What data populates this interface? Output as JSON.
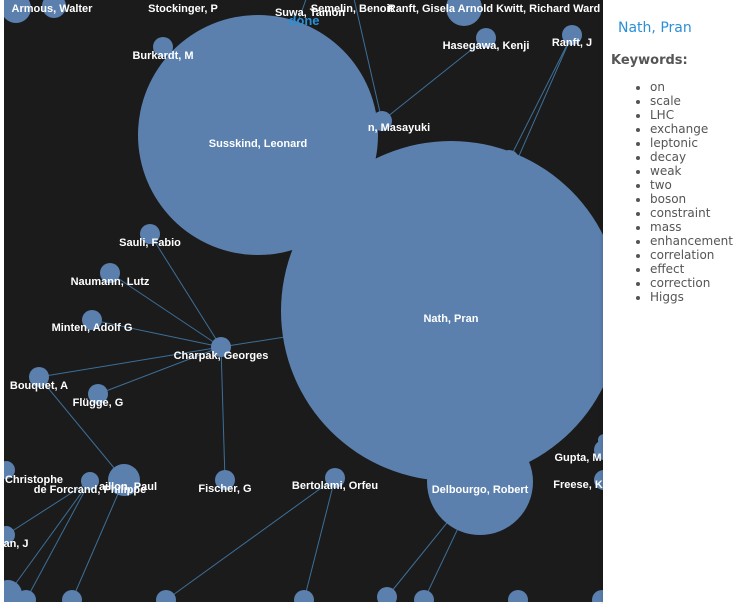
{
  "status_text": "done",
  "sidebar": {
    "selected_name": "Nath, Pran",
    "keywords_title": "Keywords:",
    "keywords": [
      "on",
      "scale",
      "LHC",
      "exchange",
      "leptonic",
      "decay",
      "weak",
      "two",
      "boson",
      "constraint",
      "mass",
      "enhancement",
      "correlation",
      "effect",
      "correction",
      "Higgs"
    ]
  },
  "graph": {
    "node_fill": "#5b80ae",
    "edge_color": "#3d6f98",
    "background": "#1b1b1b",
    "nodes": [
      {
        "id": "armous",
        "label": "Armous, Walter"
      },
      {
        "id": "stockinger",
        "label": "Stockinger, P"
      },
      {
        "id": "suwa",
        "label": "Suwa, Tamon"
      },
      {
        "id": "semelin",
        "label": "Semelin, Benoit"
      },
      {
        "id": "raft_cluster",
        "label": "Ranft, Gisela Arnold Kwitt, Richard Ward"
      },
      {
        "id": "burkardt",
        "label": "Burkardt, M"
      },
      {
        "id": "hasegawa",
        "label": "Hasegawa, Kenji"
      },
      {
        "id": "ranft",
        "label": "Ranft, J"
      },
      {
        "id": "masayuki",
        "label": "n, Masayuki"
      },
      {
        "id": "susskind",
        "label": "Susskind, Leonard"
      },
      {
        "id": "nath",
        "label": "Nath, Pran"
      },
      {
        "id": "sauli",
        "label": "Sauli, Fabio"
      },
      {
        "id": "naumann",
        "label": "Naumann, Lutz"
      },
      {
        "id": "minten",
        "label": "Minten, Adolf G"
      },
      {
        "id": "charpak",
        "label": "Charpak, Georges"
      },
      {
        "id": "bouquet",
        "label": "Bouquet, A"
      },
      {
        "id": "flugge",
        "label": "Flügge, G"
      },
      {
        "id": "christophe",
        "label": "Christophe"
      },
      {
        "id": "deforcrand",
        "label": "de Forcrand, Philippe"
      },
      {
        "id": "paul",
        "label": "aillon, Paul"
      },
      {
        "id": "fischer",
        "label": "Fischer, G"
      },
      {
        "id": "bertolami",
        "label": "Bertolami, Orfeu"
      },
      {
        "id": "delbourgo",
        "label": "Delbourgo, Robert"
      },
      {
        "id": "gupta",
        "label": "Gupta, M"
      },
      {
        "id": "freese",
        "label": "Freese, K"
      },
      {
        "id": "anj",
        "label": "an, J"
      },
      {
        "id": "b1",
        "label": ""
      },
      {
        "id": "b2",
        "label": ""
      },
      {
        "id": "b3",
        "label": ""
      },
      {
        "id": "b4",
        "label": ""
      },
      {
        "id": "b5",
        "label": ""
      },
      {
        "id": "b6",
        "label": ""
      },
      {
        "id": "b7",
        "label": ""
      },
      {
        "id": "b8",
        "label": ""
      },
      {
        "id": "b9",
        "label": ""
      },
      {
        "id": "b10",
        "label": ""
      },
      {
        "id": "tr1",
        "label": ""
      },
      {
        "id": "tr2",
        "label": ""
      }
    ],
    "edges": [
      [
        "charpak",
        "sauli"
      ],
      [
        "charpak",
        "naumann"
      ],
      [
        "charpak",
        "minten"
      ],
      [
        "charpak",
        "bouquet"
      ],
      [
        "charpak",
        "flugge"
      ],
      [
        "charpak",
        "fischer"
      ],
      [
        "charpak",
        "nath"
      ],
      [
        "masayuki",
        "susskind"
      ],
      [
        "masayuki",
        "hasegawa"
      ],
      [
        "masayuki",
        "semelin"
      ],
      [
        "nath",
        "ranft"
      ],
      [
        "nath",
        "delbourgo"
      ],
      [
        "suwa",
        "susskind"
      ],
      [
        "bouquet",
        "paul"
      ],
      [
        "deforcrand",
        "b1"
      ],
      [
        "deforcrand",
        "b2"
      ],
      [
        "deforcrand",
        "anj"
      ],
      [
        "paul",
        "b3"
      ],
      [
        "bertolami",
        "b4"
      ],
      [
        "bertolami",
        "b5"
      ],
      [
        "delbourgo",
        "b6"
      ],
      [
        "delbourgo",
        "b7"
      ],
      [
        "burkardt",
        "susskind"
      ],
      [
        "tr1",
        "ranft"
      ],
      [
        "gupta",
        "tr2"
      ]
    ]
  }
}
